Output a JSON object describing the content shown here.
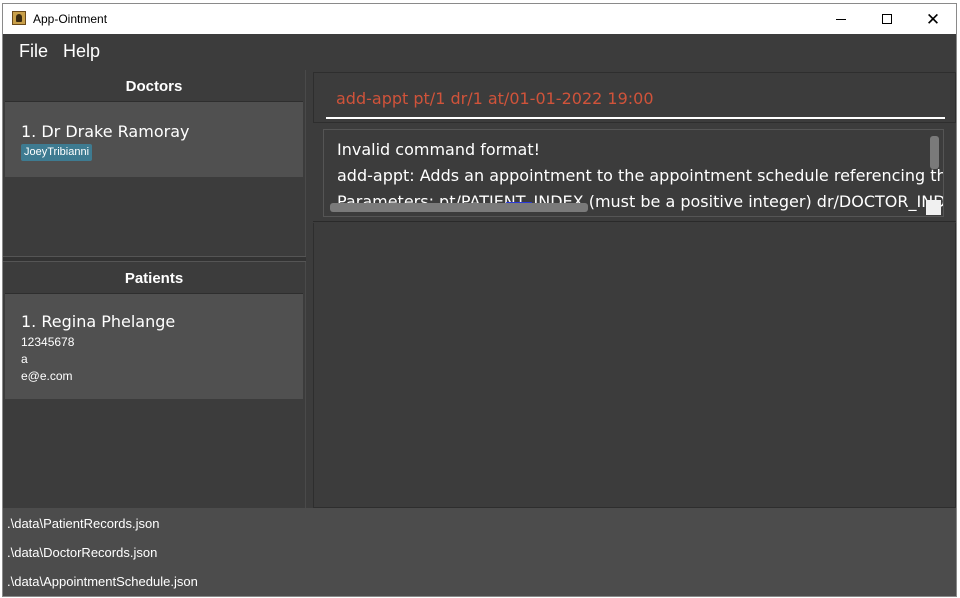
{
  "window": {
    "title": "App-Ointment"
  },
  "menu": {
    "file": "File",
    "help": "Help"
  },
  "doctors": {
    "header": "Doctors",
    "items": [
      {
        "name": "1.  Dr Drake Ramoray",
        "tag": "JoeyTribianni"
      }
    ]
  },
  "patients": {
    "header": "Patients",
    "items": [
      {
        "name": "1.  Regina Phelange",
        "phone": "12345678",
        "address": "a",
        "email": "e@e.com"
      }
    ]
  },
  "command": {
    "text": "add-appt pt/1 dr/1 at/01-01-2022 19:00",
    "color": "#d0533a"
  },
  "result": {
    "line1": "Invalid command format!",
    "line2": "add-appt: Adds an appointment to the appointment schedule referencing the ind",
    "line3": "Parameters: pt/PATIENT_INDEX (must be a positive integer) dr/DOCTOR_INDEX (m"
  },
  "status": {
    "patients_file": ".\\data\\PatientRecords.json",
    "doctors_file": ".\\data\\DoctorRecords.json",
    "appointments_file": ".\\data\\AppointmentSchedule.json"
  },
  "icons": {
    "app": "app-ointment-icon",
    "minimize": "minimize-icon",
    "maximize": "maximize-icon",
    "close": "close-icon"
  },
  "colors": {
    "background": "#3c3c3c",
    "card": "#505050",
    "tag": "#3e7b91",
    "status_bar": "#4c4c4c"
  }
}
